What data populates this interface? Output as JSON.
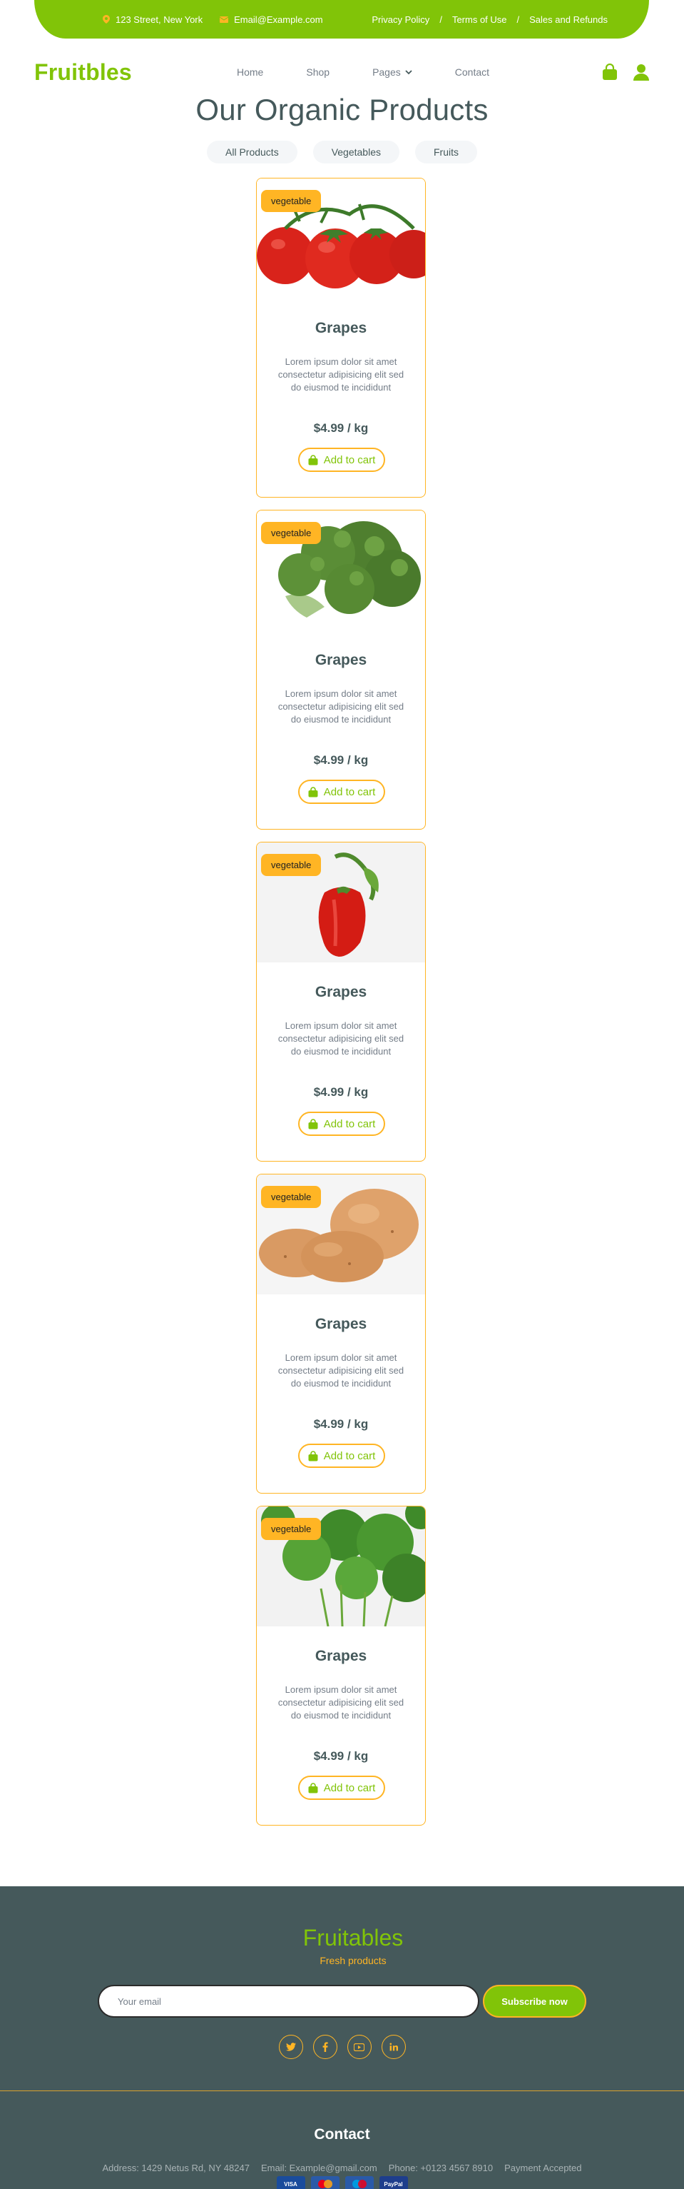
{
  "topbar": {
    "address": "123 Street, New York",
    "email": "Email@Example.com",
    "links": [
      "Privacy Policy",
      "Terms of Use",
      "Sales and Refunds"
    ]
  },
  "navbar": {
    "brand": "Fruitbles",
    "links": [
      "Home",
      "Shop",
      "Pages",
      "Contact"
    ]
  },
  "main": {
    "heading": "Our Organic Products",
    "filters": [
      "All Products",
      "Vegetables",
      "Fruits"
    ]
  },
  "products": [
    {
      "badge": "vegetable",
      "title": "Grapes",
      "desc": "Lorem ipsum dolor sit amet consectetur adipisicing elit sed do eiusmod te incididunt",
      "price": "$4.99 / kg",
      "cart": "Add to cart",
      "image": "tomatoes"
    },
    {
      "badge": "vegetable",
      "title": "Grapes",
      "desc": "Lorem ipsum dolor sit amet consectetur adipisicing elit sed do eiusmod te incididunt",
      "price": "$4.99 / kg",
      "cart": "Add to cart",
      "image": "broccoli"
    },
    {
      "badge": "vegetable",
      "title": "Grapes",
      "desc": "Lorem ipsum dolor sit amet consectetur adipisicing elit sed do eiusmod te incididunt",
      "price": "$4.99 / kg",
      "cart": "Add to cart",
      "image": "bell-pepper"
    },
    {
      "badge": "vegetable",
      "title": "Grapes",
      "desc": "Lorem ipsum dolor sit amet consectetur adipisicing elit sed do eiusmod te incididunt",
      "price": "$4.99 / kg",
      "cart": "Add to cart",
      "image": "potatoes"
    },
    {
      "badge": "vegetable",
      "title": "Grapes",
      "desc": "Lorem ipsum dolor sit amet consectetur adipisicing elit sed do eiusmod te incididunt",
      "price": "$4.99 / kg",
      "cart": "Add to cart",
      "image": "parsley"
    }
  ],
  "footer": {
    "brand": "Fruitables",
    "tagline": "Fresh products",
    "email_placeholder": "Your email",
    "subscribe": "Subscribe now",
    "socials": [
      "twitter-icon",
      "facebook-icon",
      "youtube-icon",
      "linkedin-icon"
    ],
    "contact_title": "Contact",
    "address": "Address: 1429 Netus Rd, NY 48247",
    "email": "Email: Example@gmail.com",
    "phone": "Phone: +0123 4567 8910",
    "payment_label": "Payment Accepted",
    "payments": [
      "VISA",
      "Mastercard",
      "Maestro",
      "PayPal"
    ]
  },
  "colors": {
    "primary": "#81c408",
    "secondary": "#ffb524",
    "dark": "#45595b",
    "muted": "#747d88"
  }
}
